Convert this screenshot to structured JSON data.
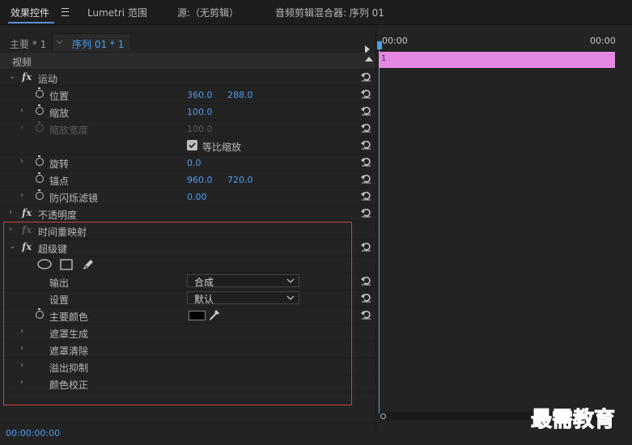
{
  "tabs": [
    "效果控件",
    "Lumetri 范围",
    "源:（无剪辑）",
    "音频剪辑混合器: 序列 01"
  ],
  "master_label": "主要 * 1",
  "sequence_label": "序列 01 * 1",
  "section_video": "视频",
  "effects": {
    "motion": "运动",
    "position": {
      "label": "位置",
      "x": "360.0",
      "y": "288.0"
    },
    "scale": {
      "label": "缩放",
      "value": "100.0"
    },
    "scale_width": {
      "label": "缩放宽度",
      "value": "100.0"
    },
    "uniform_scale": "等比缩放",
    "rotation": {
      "label": "旋转",
      "value": "0.0"
    },
    "anchor": {
      "label": "锚点",
      "x": "960.0",
      "y": "720.0"
    },
    "anti_flicker": {
      "label": "防闪烁滤镜",
      "value": "0.00"
    },
    "opacity": "不透明度",
    "time_remap": "时间重映射",
    "ultra_key": "超级键",
    "output": {
      "label": "输出",
      "value": "合成"
    },
    "setting": {
      "label": "设置",
      "value": "默认"
    },
    "key_color": "主要颜色",
    "matte_generation": "遮罩生成",
    "matte_cleanup": "遮罩清除",
    "spill_suppression": "溢出抑制",
    "color_correction": "颜色校正"
  },
  "fx_symbol": "fx",
  "timeline": {
    "start": "00:00",
    "end": "00:00",
    "clip_label": "1"
  },
  "timecode": "00:00:00:00",
  "watermark": "最需教育",
  "colors": {
    "accent": "#4d9cf0",
    "clip": "#e488e3",
    "highlight_box": "#d0413f"
  }
}
